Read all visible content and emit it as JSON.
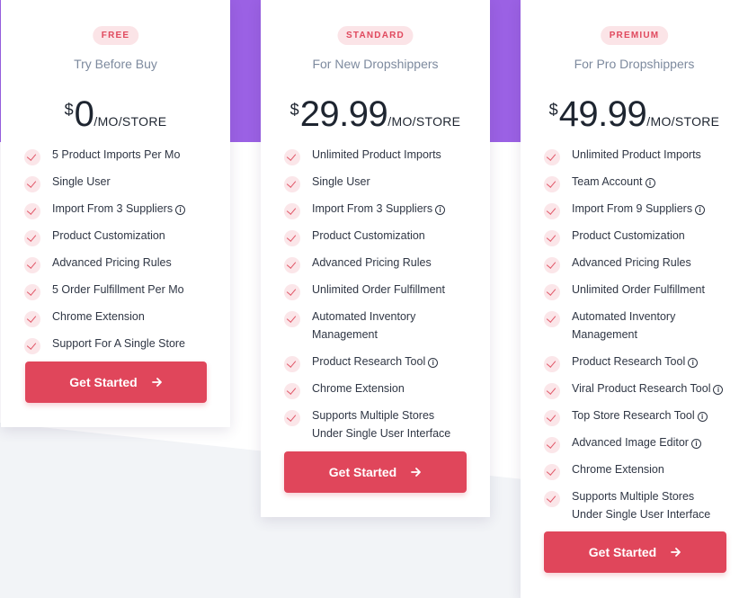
{
  "colors": {
    "accent": "#e0465b",
    "badge_bg": "#fbe4e7",
    "purple_bg": "#9b61e4",
    "subtitle": "#7d8a9e",
    "text": "#2f3644"
  },
  "plans": [
    {
      "badge": "FREE",
      "subtitle": "Try Before Buy",
      "currency": "$",
      "amount": "0",
      "period": "/MO/STORE",
      "features": [
        {
          "text": "5 Product Imports Per Mo",
          "info": false
        },
        {
          "text": "Single User",
          "info": false
        },
        {
          "text": "Import From 3 Suppliers",
          "info": true
        },
        {
          "text": "Product Customization",
          "info": false
        },
        {
          "text": "Advanced Pricing Rules",
          "info": false
        },
        {
          "text": "5 Order Fulfillment Per Mo",
          "info": false
        },
        {
          "text": "Chrome Extension",
          "info": false
        },
        {
          "text": "Support For A Single Store",
          "info": false
        }
      ],
      "cta": "Get Started"
    },
    {
      "badge": "STANDARD",
      "subtitle": "For New Dropshippers",
      "currency": "$",
      "amount": "29.99",
      "period": "/MO/STORE",
      "features": [
        {
          "text": "Unlimited Product Imports",
          "info": false
        },
        {
          "text": "Single User",
          "info": false
        },
        {
          "text": "Import From 3 Suppliers",
          "info": true
        },
        {
          "text": "Product Customization",
          "info": false
        },
        {
          "text": "Advanced Pricing Rules",
          "info": false
        },
        {
          "text": "Unlimited Order Fulfillment",
          "info": false
        },
        {
          "text": "Automated Inventory Management",
          "info": false
        },
        {
          "text": "Product Research Tool",
          "info": true
        },
        {
          "text": "Chrome Extension",
          "info": false
        },
        {
          "text": "Supports Multiple Stores Under Single User Interface",
          "info": false
        }
      ],
      "cta": "Get Started"
    },
    {
      "badge": "PREMIUM",
      "subtitle": "For Pro Dropshippers",
      "currency": "$",
      "amount": "49.99",
      "period": "/MO/STORE",
      "features": [
        {
          "text": "Unlimited Product Imports",
          "info": false
        },
        {
          "text": "Team Account",
          "info": true
        },
        {
          "text": "Import From 9 Suppliers",
          "info": true
        },
        {
          "text": "Product Customization",
          "info": false
        },
        {
          "text": "Advanced Pricing Rules",
          "info": false
        },
        {
          "text": "Unlimited Order Fulfillment",
          "info": false
        },
        {
          "text": "Automated Inventory Management",
          "info": false
        },
        {
          "text": "Product Research Tool",
          "info": true
        },
        {
          "text": "Viral Product Research Tool",
          "info": true
        },
        {
          "text": "Top Store Research Tool",
          "info": true
        },
        {
          "text": "Advanced Image Editor",
          "info": true
        },
        {
          "text": "Chrome Extension",
          "info": false
        },
        {
          "text": "Supports Multiple Stores Under Single User Interface",
          "info": false
        }
      ],
      "cta": "Get Started"
    }
  ]
}
